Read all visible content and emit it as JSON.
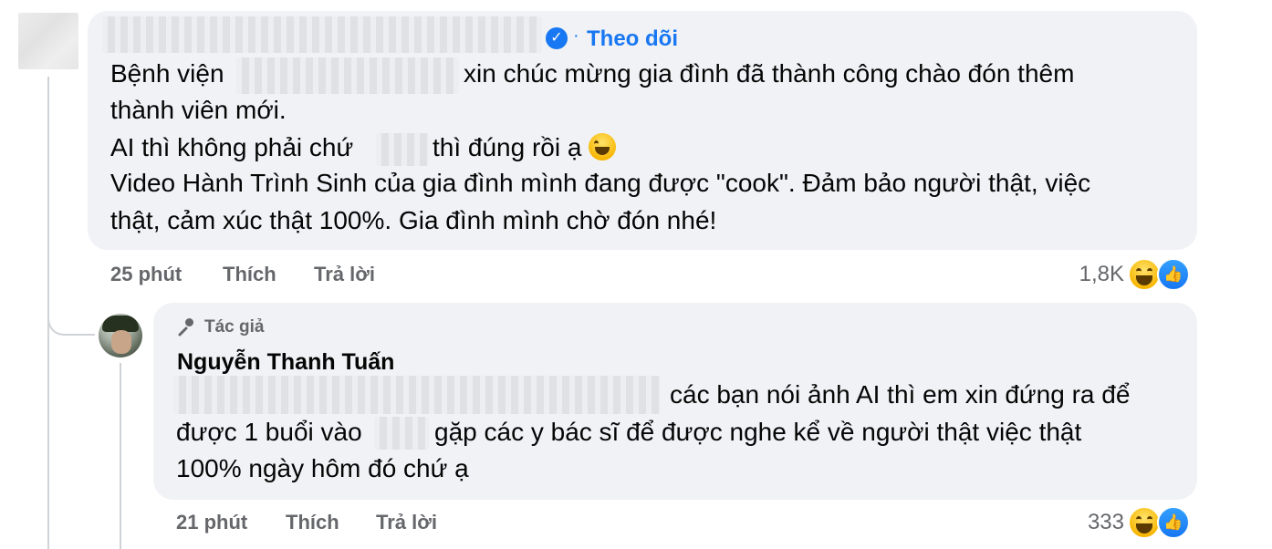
{
  "comment": {
    "follow_label": "Theo dõi",
    "lines": [
      [
        "Bệnh viện",
        "xin chúc mừng gia đình đã thành công chào đón thêm"
      ],
      [
        "thành viên mới."
      ],
      [
        "AI thì không phải chứ",
        "thì đúng rồi ạ"
      ],
      [
        "Video Hành Trình Sinh của gia đình mình đang được \"cook\". Đảm bảo người thật, việc"
      ],
      [
        "thật, cảm xúc thật 100%. Gia đình mình chờ đón nhé!"
      ]
    ],
    "time": "25 phút",
    "like_label": "Thích",
    "reply_label": "Trả lời",
    "reaction_count": "1,8K"
  },
  "reply": {
    "author_badge": "Tác giả",
    "author_name": "Nguyễn Thanh Tuấn",
    "lines": [
      [
        "các bạn nói ảnh AI thì em xin đứng ra để"
      ],
      [
        "được 1 buổi vào",
        "gặp các y bác sĩ để được nghe kể về người thật việc thật"
      ],
      [
        "100% ngày hôm đó chứ ạ"
      ]
    ],
    "time": "21 phút",
    "like_label": "Thích",
    "reply_label": "Trả lời",
    "reaction_count": "333"
  },
  "icons": {
    "verified": "verified-badge-icon",
    "emoji": "grinning-face-emoji",
    "reactions": [
      "haha-reaction-icon",
      "like-reaction-icon"
    ],
    "author_badge": "microphone-icon"
  },
  "colors": {
    "accent": "#1877f2",
    "bubble": "#f0f2f5",
    "meta_text": "#65676b"
  }
}
